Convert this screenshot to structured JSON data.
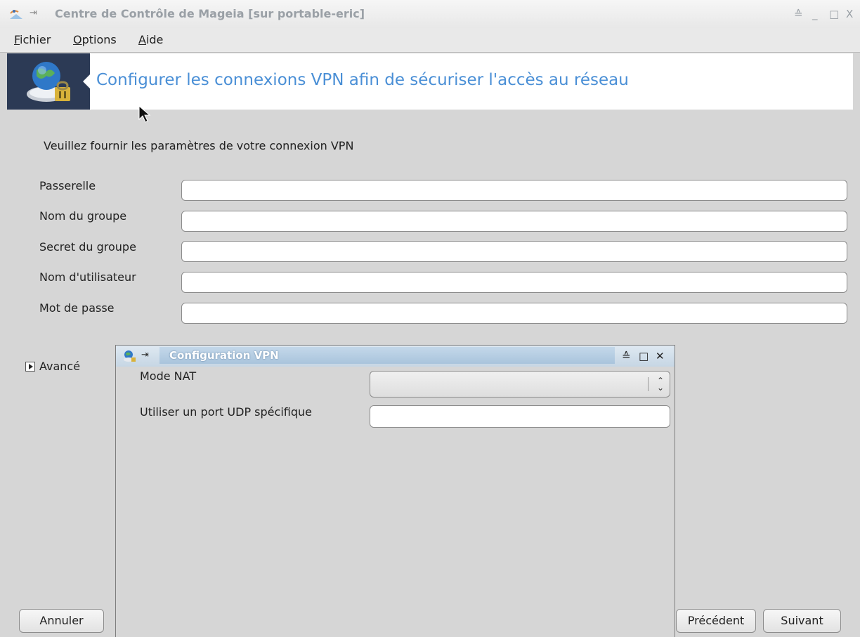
{
  "window": {
    "title": "Centre de Contrôle de Mageia  [sur portable-eric]",
    "controls": [
      "≙",
      "_",
      "□",
      "X"
    ]
  },
  "menu": [
    {
      "mnemonic": "F",
      "rest": "ichier"
    },
    {
      "mnemonic": "O",
      "rest": "ptions"
    },
    {
      "mnemonic": "A",
      "rest": "ide"
    }
  ],
  "banner": {
    "title": "Configurer les connexions VPN afin de sécuriser l'accès au réseau"
  },
  "form": {
    "intro": "Veuillez fournir les paramètres de votre connexion VPN",
    "fields": [
      {
        "label": "Passerelle",
        "value": ""
      },
      {
        "label": "Nom du groupe",
        "value": ""
      },
      {
        "label": "Secret du groupe",
        "value": ""
      },
      {
        "label": "Nom d'utilisateur",
        "value": ""
      },
      {
        "label": "Mot de passe",
        "value": ""
      }
    ],
    "advanced_label": "Avancé"
  },
  "buttons": {
    "cancel": "Annuler",
    "previous": "Précédent",
    "next": "Suivant"
  },
  "dialog": {
    "title": "Configuration VPN",
    "controls": [
      "≙",
      "□",
      "✕"
    ],
    "nat_label": "Mode NAT",
    "nat_value": "",
    "udp_label": "Utiliser un port UDP spécifique",
    "udp_value": ""
  },
  "colors": {
    "accent": "#4a8fd6",
    "banner_dark": "#2c3a55",
    "dialog_title": "#a9c4dc"
  }
}
